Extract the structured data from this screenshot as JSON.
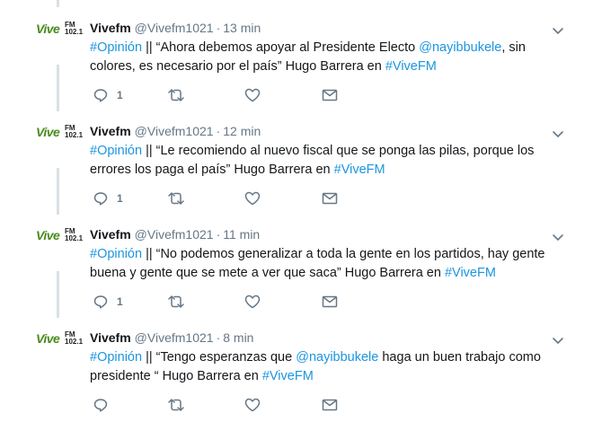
{
  "colors": {
    "link": "#1b95e0",
    "muted": "#657786",
    "brand_green": "#4a8a1e"
  },
  "avatar": {
    "brand": "Vive",
    "fm": "FM",
    "freq": "102.1"
  },
  "tweets": [
    {
      "name": "Vivefm",
      "handle": "@Vivefm1021",
      "dot": "·",
      "time": "13 min",
      "parts": [
        {
          "t": "#Opinión",
          "link": true
        },
        {
          "t": " || “Ahora debemos apoyar al Presidente Electo ",
          "link": false
        },
        {
          "t": "@nayibbukele",
          "link": true
        },
        {
          "t": ", sin colores, es necesario por el país” Hugo Barrera en ",
          "link": false
        },
        {
          "t": "#ViveFM",
          "link": true
        }
      ],
      "reply_count": "1"
    },
    {
      "name": "Vivefm",
      "handle": "@Vivefm1021",
      "dot": "·",
      "time": "12 min",
      "parts": [
        {
          "t": "#Opinión",
          "link": true
        },
        {
          "t": " || “Le recomiendo al nuevo fiscal que se ponga las pilas, porque los errores los paga el país” Hugo Barrera en ",
          "link": false
        },
        {
          "t": "#ViveFM",
          "link": true
        }
      ],
      "reply_count": "1"
    },
    {
      "name": "Vivefm",
      "handle": "@Vivefm1021",
      "dot": "·",
      "time": "11 min",
      "parts": [
        {
          "t": "#Opinión",
          "link": true
        },
        {
          "t": " || “No podemos generalizar a toda la gente en los partidos, hay gente buena y gente que se mete a ver que saca” Hugo Barrera en ",
          "link": false
        },
        {
          "t": "#ViveFM",
          "link": true
        }
      ],
      "reply_count": "1"
    },
    {
      "name": "Vivefm",
      "handle": "@Vivefm1021",
      "dot": "·",
      "time": "8 min",
      "parts": [
        {
          "t": "#Opinión",
          "link": true
        },
        {
          "t": " || “Tengo esperanzas que ",
          "link": false
        },
        {
          "t": "@nayibbukele",
          "link": true
        },
        {
          "t": " haga un buen trabajo como presidente “ Hugo Barrera en ",
          "link": false
        },
        {
          "t": "#ViveFM",
          "link": true
        }
      ],
      "reply_count": ""
    }
  ]
}
